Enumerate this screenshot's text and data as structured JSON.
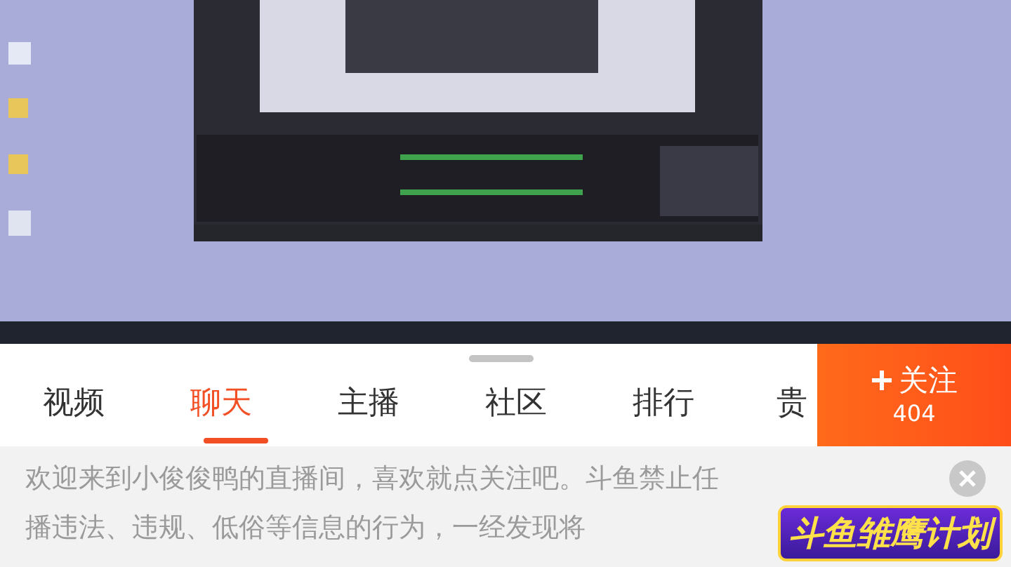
{
  "tabs": [
    {
      "label": "视频",
      "selected": false
    },
    {
      "label": "聊天",
      "selected": true
    },
    {
      "label": "主播",
      "selected": false
    },
    {
      "label": "社区",
      "selected": false
    },
    {
      "label": "排行",
      "selected": false
    },
    {
      "label": "贵",
      "selected": false
    }
  ],
  "follow_button": {
    "label": "关注",
    "count": "404"
  },
  "notice": {
    "lines": [
      "欢迎来到小俊俊鸭的直播间，喜欢就点关注吧。斗鱼禁止任",
      "播违法、违规、低俗等信息的行为，一经发现将"
    ]
  },
  "promo_badge": {
    "label": "斗鱼雏鹰计划"
  }
}
